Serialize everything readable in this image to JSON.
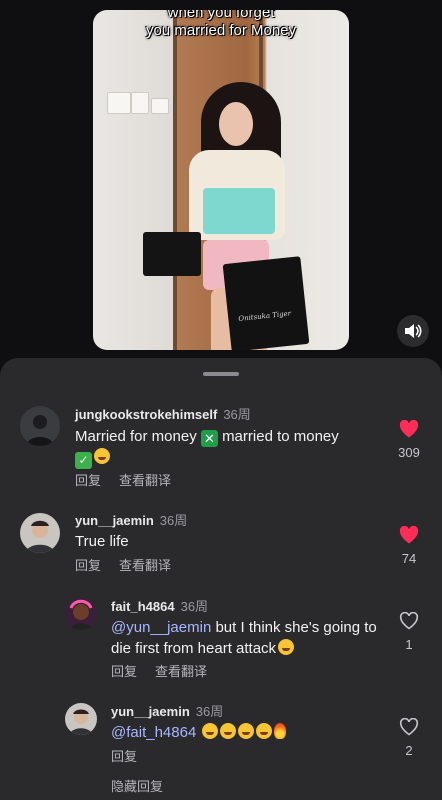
{
  "video": {
    "caption_line1": "when you forget",
    "caption_line2": "you married for Money",
    "bag_brand": "Onitsuka Tiger"
  },
  "sound_button": {
    "icon": "speaker-icon"
  },
  "colors": {
    "sheet_bg": "#2a2a2d",
    "like_active": "#ff2d55",
    "mention": "#a9b7ff"
  },
  "actions": {
    "reply": "回复",
    "translate": "查看翻译",
    "hide_replies": "隐藏回复"
  },
  "comments": [
    {
      "user": "jungkookstrokehimself",
      "time": "36周",
      "text_part1": "Married for money",
      "text_part2": "married to money",
      "likes": "309",
      "liked": true
    },
    {
      "user": "yun__jaemin",
      "time": "36周",
      "text": "True life",
      "likes": "74",
      "liked": true
    },
    {
      "user": "fait_h4864",
      "time": "36周",
      "mention": "@yun__jaemin",
      "text": " but I think she's going to die first from heart attack",
      "likes": "1",
      "liked": false
    },
    {
      "user": "yun__jaemin",
      "time": "36周",
      "mention": "@fait_h4864",
      "likes": "2",
      "liked": false
    }
  ]
}
